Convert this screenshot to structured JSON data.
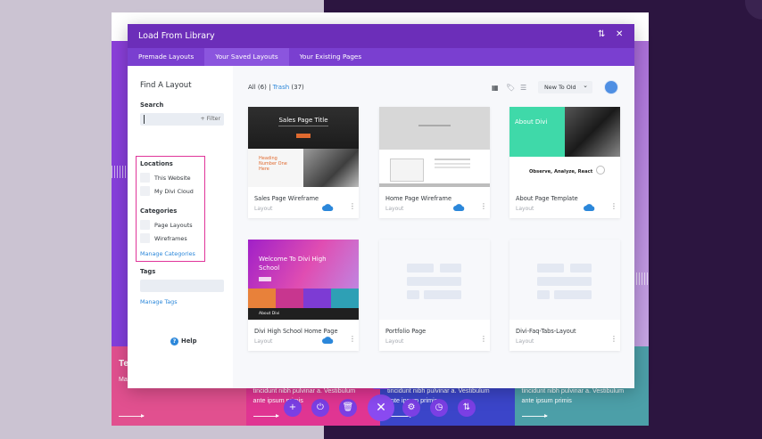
{
  "modal": {
    "title": "Load From Library",
    "tabs": [
      "Premade Layouts",
      "Your Saved Layouts",
      "Your Existing Pages"
    ],
    "active_tab": "Your Saved Layouts"
  },
  "sidebar": {
    "title": "Find A Layout",
    "search_label": "Search",
    "filter_label": "+ Filter",
    "locations_label": "Locations",
    "locations": [
      "This Website",
      "My Divi Cloud"
    ],
    "categories_label": "Categories",
    "categories": [
      "Page Layouts",
      "Wireframes"
    ],
    "manage_categories": "Manage Categories",
    "tags_label": "Tags",
    "manage_tags": "Manage Tags",
    "help": "Help"
  },
  "main": {
    "all_label": "All (6)",
    "separator": "|",
    "trash_label": "Trash",
    "trash_count": "(37)",
    "sort_value": "New To Old",
    "cards": [
      {
        "name": "Sales Page Wireframe",
        "type": "Layout",
        "cloud": true
      },
      {
        "name": "Home Page Wireframe",
        "type": "Layout",
        "cloud": true
      },
      {
        "name": "About Page Template",
        "type": "Layout",
        "cloud": true
      },
      {
        "name": "Divi High School Home Page",
        "type": "Layout",
        "cloud": true
      },
      {
        "name": "Portfolio Page",
        "type": "Layout",
        "cloud": false
      },
      {
        "name": "Divi-Faq-Tabs-Layout",
        "type": "Layout",
        "cloud": false
      }
    ],
    "thumbs": {
      "sales_title": "Sales Page Title",
      "sales_heading": "Heading Number One Here",
      "about_title": "About Divi",
      "about_tagline": "Observe, Analyze, React",
      "school_title": "Welcome To Divi High School",
      "school_footer": "About Divi"
    }
  },
  "background": {
    "tile_heading": "Te",
    "tile_cut": "Ma",
    "tile_text": [
      "tincidunt nibh pulvinar a. Vestibulum",
      "ante ipsum primis"
    ],
    "tile_colors": [
      "#e1508f",
      "#e03592",
      "#3b45c9",
      "#4c9fa8"
    ]
  },
  "colors": {
    "brand_purple": "#6c2eb9",
    "tab_bar": "#7a3fd0",
    "link_blue": "#2b87da",
    "highlight_pink": "#e0359a"
  },
  "icons": {
    "sort": "sort-icon",
    "close": "close-icon",
    "grid": "grid-view-icon",
    "tag": "tag-icon",
    "list": "list-view-icon",
    "cloud": "cloud-icon",
    "more": "more-dots-icon",
    "help": "help-icon"
  },
  "toolbar": {
    "buttons": [
      "add-icon",
      "power-icon",
      "trash-icon",
      "close-icon",
      "settings-icon",
      "history-icon",
      "sort-icon"
    ]
  }
}
